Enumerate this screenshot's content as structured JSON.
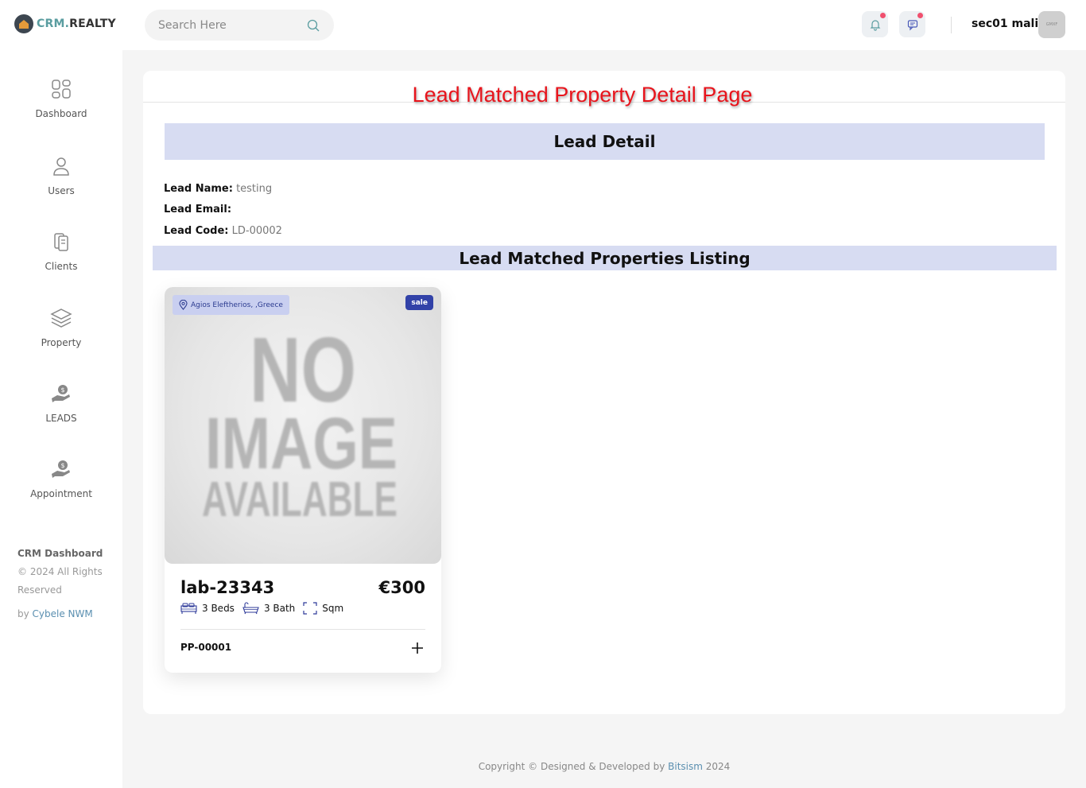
{
  "brand": {
    "name_part1": "CRM.",
    "name_part2": "REALTY"
  },
  "search": {
    "placeholder": "Search Here"
  },
  "user": {
    "name": "sec01 mali",
    "avatar_text": "GMXF"
  },
  "sidebar": {
    "items": [
      {
        "label": "Dashboard",
        "icon": "dashboard-icon"
      },
      {
        "label": "Users",
        "icon": "user-icon"
      },
      {
        "label": "Clients",
        "icon": "clients-icon"
      },
      {
        "label": "Property",
        "icon": "layers-icon"
      },
      {
        "label": "LEADS",
        "icon": "leads-icon"
      },
      {
        "label": "Appointment",
        "icon": "appointment-icon"
      }
    ],
    "footer": {
      "title": "CRM Dashboard",
      "rights_line1": "© 2024 All Rights",
      "rights_line2": "Reserved",
      "by_prefix": "by ",
      "by_name": "Cybele NWM"
    }
  },
  "page": {
    "title": "Lead Matched Property Detail Page",
    "lead_section_title": "Lead Detail",
    "props_section_title": "Lead Matched Properties Listing"
  },
  "lead": {
    "name_label": "Lead Name:",
    "name_value": "testing",
    "email_label": "Lead Email:",
    "email_value": "",
    "code_label": "Lead Code:",
    "code_value": "LD-00002"
  },
  "properties": [
    {
      "location": "Agios Eleftherios, ,Greece",
      "status": "sale",
      "image_text": [
        "NO",
        "IMAGE",
        "AVAILABLE"
      ],
      "name": "lab-23343",
      "price": "€300",
      "beds": "3 Beds",
      "baths": "3 Bath",
      "area": "Sqm",
      "code": "PP-00001"
    }
  ],
  "footer": {
    "prefix": "Copyright © Designed & Developed by ",
    "brand": "Bitsism",
    "year": " 2024"
  },
  "colors": {
    "accent_teal": "#5a9da0",
    "band_bg": "#d7dcf2",
    "title_red": "#e8141c",
    "sale_badge": "#3242a8",
    "notification_dot": "#f0506e"
  }
}
